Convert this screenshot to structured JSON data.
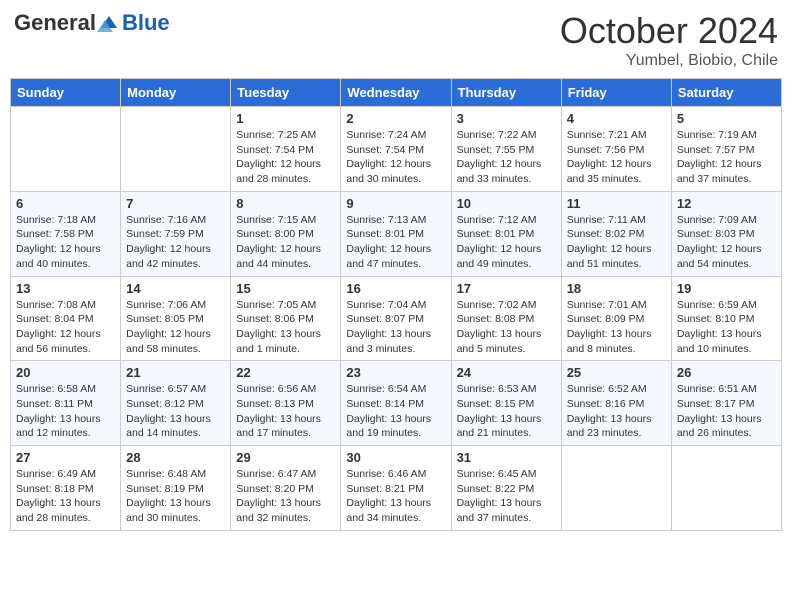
{
  "header": {
    "logo": {
      "general": "General",
      "blue": "Blue"
    },
    "title": "October 2024",
    "subtitle": "Yumbel, Biobio, Chile"
  },
  "days_of_week": [
    "Sunday",
    "Monday",
    "Tuesday",
    "Wednesday",
    "Thursday",
    "Friday",
    "Saturday"
  ],
  "weeks": [
    [
      {
        "day": "",
        "sunrise": "",
        "sunset": "",
        "daylight": ""
      },
      {
        "day": "",
        "sunrise": "",
        "sunset": "",
        "daylight": ""
      },
      {
        "day": "1",
        "sunrise": "Sunrise: 7:25 AM",
        "sunset": "Sunset: 7:54 PM",
        "daylight": "Daylight: 12 hours and 28 minutes."
      },
      {
        "day": "2",
        "sunrise": "Sunrise: 7:24 AM",
        "sunset": "Sunset: 7:54 PM",
        "daylight": "Daylight: 12 hours and 30 minutes."
      },
      {
        "day": "3",
        "sunrise": "Sunrise: 7:22 AM",
        "sunset": "Sunset: 7:55 PM",
        "daylight": "Daylight: 12 hours and 33 minutes."
      },
      {
        "day": "4",
        "sunrise": "Sunrise: 7:21 AM",
        "sunset": "Sunset: 7:56 PM",
        "daylight": "Daylight: 12 hours and 35 minutes."
      },
      {
        "day": "5",
        "sunrise": "Sunrise: 7:19 AM",
        "sunset": "Sunset: 7:57 PM",
        "daylight": "Daylight: 12 hours and 37 minutes."
      }
    ],
    [
      {
        "day": "6",
        "sunrise": "Sunrise: 7:18 AM",
        "sunset": "Sunset: 7:58 PM",
        "daylight": "Daylight: 12 hours and 40 minutes."
      },
      {
        "day": "7",
        "sunrise": "Sunrise: 7:16 AM",
        "sunset": "Sunset: 7:59 PM",
        "daylight": "Daylight: 12 hours and 42 minutes."
      },
      {
        "day": "8",
        "sunrise": "Sunrise: 7:15 AM",
        "sunset": "Sunset: 8:00 PM",
        "daylight": "Daylight: 12 hours and 44 minutes."
      },
      {
        "day": "9",
        "sunrise": "Sunrise: 7:13 AM",
        "sunset": "Sunset: 8:01 PM",
        "daylight": "Daylight: 12 hours and 47 minutes."
      },
      {
        "day": "10",
        "sunrise": "Sunrise: 7:12 AM",
        "sunset": "Sunset: 8:01 PM",
        "daylight": "Daylight: 12 hours and 49 minutes."
      },
      {
        "day": "11",
        "sunrise": "Sunrise: 7:11 AM",
        "sunset": "Sunset: 8:02 PM",
        "daylight": "Daylight: 12 hours and 51 minutes."
      },
      {
        "day": "12",
        "sunrise": "Sunrise: 7:09 AM",
        "sunset": "Sunset: 8:03 PM",
        "daylight": "Daylight: 12 hours and 54 minutes."
      }
    ],
    [
      {
        "day": "13",
        "sunrise": "Sunrise: 7:08 AM",
        "sunset": "Sunset: 8:04 PM",
        "daylight": "Daylight: 12 hours and 56 minutes."
      },
      {
        "day": "14",
        "sunrise": "Sunrise: 7:06 AM",
        "sunset": "Sunset: 8:05 PM",
        "daylight": "Daylight: 12 hours and 58 minutes."
      },
      {
        "day": "15",
        "sunrise": "Sunrise: 7:05 AM",
        "sunset": "Sunset: 8:06 PM",
        "daylight": "Daylight: 13 hours and 1 minute."
      },
      {
        "day": "16",
        "sunrise": "Sunrise: 7:04 AM",
        "sunset": "Sunset: 8:07 PM",
        "daylight": "Daylight: 13 hours and 3 minutes."
      },
      {
        "day": "17",
        "sunrise": "Sunrise: 7:02 AM",
        "sunset": "Sunset: 8:08 PM",
        "daylight": "Daylight: 13 hours and 5 minutes."
      },
      {
        "day": "18",
        "sunrise": "Sunrise: 7:01 AM",
        "sunset": "Sunset: 8:09 PM",
        "daylight": "Daylight: 13 hours and 8 minutes."
      },
      {
        "day": "19",
        "sunrise": "Sunrise: 6:59 AM",
        "sunset": "Sunset: 8:10 PM",
        "daylight": "Daylight: 13 hours and 10 minutes."
      }
    ],
    [
      {
        "day": "20",
        "sunrise": "Sunrise: 6:58 AM",
        "sunset": "Sunset: 8:11 PM",
        "daylight": "Daylight: 13 hours and 12 minutes."
      },
      {
        "day": "21",
        "sunrise": "Sunrise: 6:57 AM",
        "sunset": "Sunset: 8:12 PM",
        "daylight": "Daylight: 13 hours and 14 minutes."
      },
      {
        "day": "22",
        "sunrise": "Sunrise: 6:56 AM",
        "sunset": "Sunset: 8:13 PM",
        "daylight": "Daylight: 13 hours and 17 minutes."
      },
      {
        "day": "23",
        "sunrise": "Sunrise: 6:54 AM",
        "sunset": "Sunset: 8:14 PM",
        "daylight": "Daylight: 13 hours and 19 minutes."
      },
      {
        "day": "24",
        "sunrise": "Sunrise: 6:53 AM",
        "sunset": "Sunset: 8:15 PM",
        "daylight": "Daylight: 13 hours and 21 minutes."
      },
      {
        "day": "25",
        "sunrise": "Sunrise: 6:52 AM",
        "sunset": "Sunset: 8:16 PM",
        "daylight": "Daylight: 13 hours and 23 minutes."
      },
      {
        "day": "26",
        "sunrise": "Sunrise: 6:51 AM",
        "sunset": "Sunset: 8:17 PM",
        "daylight": "Daylight: 13 hours and 26 minutes."
      }
    ],
    [
      {
        "day": "27",
        "sunrise": "Sunrise: 6:49 AM",
        "sunset": "Sunset: 8:18 PM",
        "daylight": "Daylight: 13 hours and 28 minutes."
      },
      {
        "day": "28",
        "sunrise": "Sunrise: 6:48 AM",
        "sunset": "Sunset: 8:19 PM",
        "daylight": "Daylight: 13 hours and 30 minutes."
      },
      {
        "day": "29",
        "sunrise": "Sunrise: 6:47 AM",
        "sunset": "Sunset: 8:20 PM",
        "daylight": "Daylight: 13 hours and 32 minutes."
      },
      {
        "day": "30",
        "sunrise": "Sunrise: 6:46 AM",
        "sunset": "Sunset: 8:21 PM",
        "daylight": "Daylight: 13 hours and 34 minutes."
      },
      {
        "day": "31",
        "sunrise": "Sunrise: 6:45 AM",
        "sunset": "Sunset: 8:22 PM",
        "daylight": "Daylight: 13 hours and 37 minutes."
      },
      {
        "day": "",
        "sunrise": "",
        "sunset": "",
        "daylight": ""
      },
      {
        "day": "",
        "sunrise": "",
        "sunset": "",
        "daylight": ""
      }
    ]
  ]
}
